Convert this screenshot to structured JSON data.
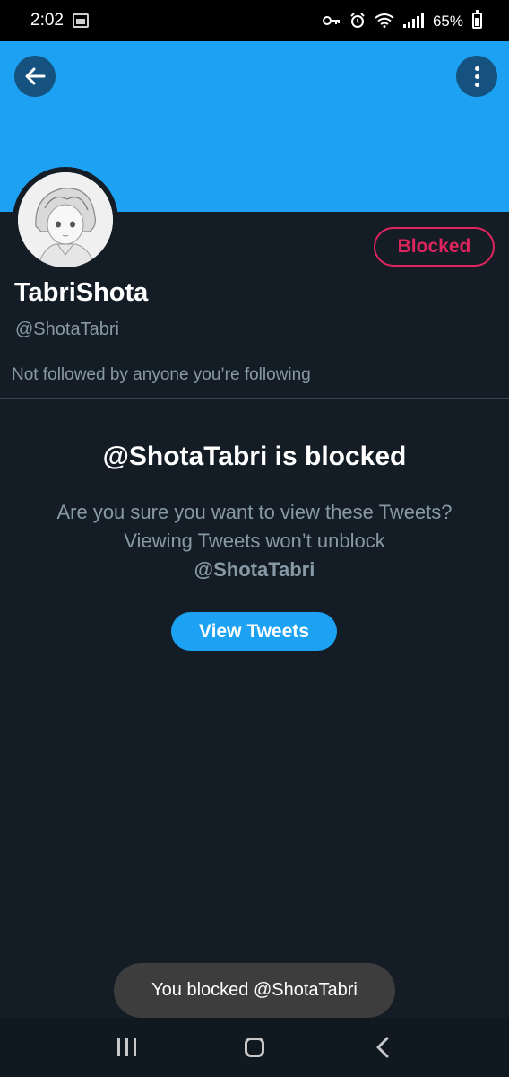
{
  "status_bar": {
    "time": "2:02",
    "battery": "65%",
    "icons": [
      "gallery-icon",
      "key-icon",
      "alarm-icon",
      "wifi-icon",
      "signal-icon",
      "battery-icon"
    ]
  },
  "header": {
    "back_icon": "arrow-left-icon",
    "more_icon": "more-vertical-icon",
    "banner_color": "#1da1f2"
  },
  "profile": {
    "display_name": "TabriShota",
    "handle": "@ShotaTabri",
    "followers_note": "Not followed by anyone you’re following",
    "blocked_label": "Blocked"
  },
  "blocked_notice": {
    "title": "@ShotaTabri is blocked",
    "body": "Are you sure you want to view these Tweets? Viewing Tweets won’t unblock",
    "body_handle": "@ShotaTabri",
    "view_button": "View Tweets"
  },
  "toast": {
    "message": "You blocked @ShotaTabri"
  },
  "nav": {
    "icons": [
      "recents-icon",
      "home-icon",
      "back-icon"
    ]
  },
  "colors": {
    "accent": "#1da1f2",
    "blocked": "#e0245e",
    "background": "#141d26",
    "secondary_text": "#8899a6"
  }
}
